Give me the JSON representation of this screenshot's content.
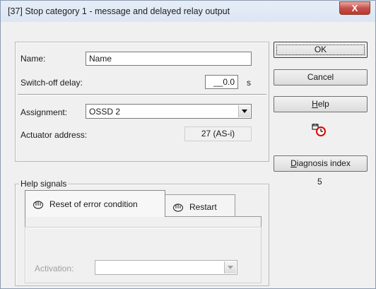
{
  "window": {
    "title": "[37] Stop category 1 - message and delayed relay output",
    "close_symbol": "X"
  },
  "form": {
    "name_label": "Name:",
    "name_value": "Name",
    "switch_off_label": "Switch-off delay:",
    "switch_off_value": "__0.0",
    "switch_off_unit": "s",
    "assignment_label": "Assignment:",
    "assignment_value": "OSSD 2",
    "actuator_label": "Actuator address:",
    "actuator_value": "27 (AS-i)"
  },
  "buttons": {
    "ok": "OK",
    "cancel": "Cancel",
    "help_underlined": "H",
    "help_rest": "elp",
    "diagnosis_underlined": "D",
    "diagnosis_rest": "iagnosis index",
    "diagnosis_value": "5"
  },
  "help_signals": {
    "group_label": "Help signals",
    "tabs": [
      {
        "label": "Reset of error condition",
        "icon": "hand-pointer-icon"
      },
      {
        "label": "Restart",
        "icon": "hand-pointer-icon"
      }
    ],
    "activation_label": "Activation:",
    "activation_value": ""
  },
  "icons": {
    "timer": "calendar-clock-icon"
  }
}
